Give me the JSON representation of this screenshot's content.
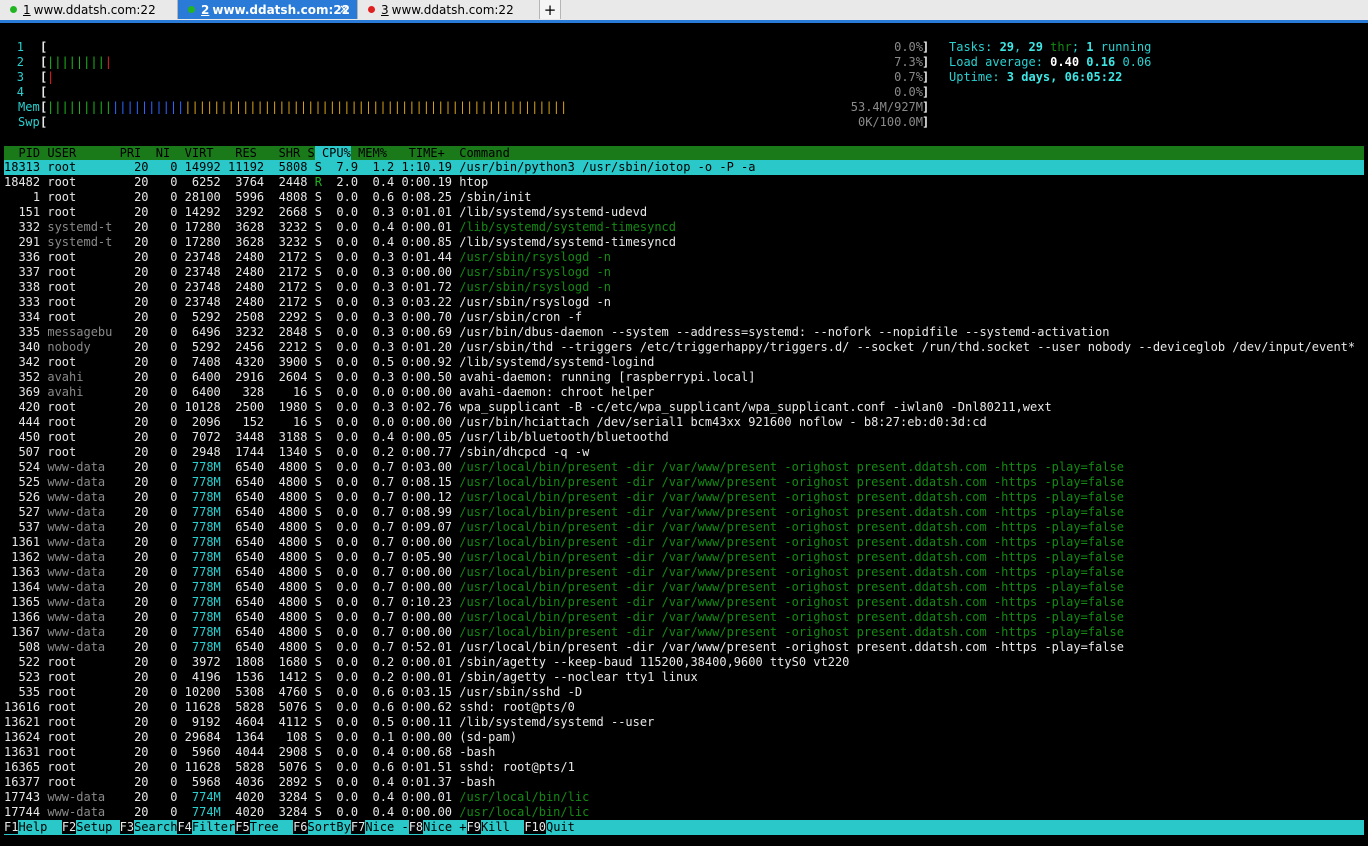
{
  "tabs": [
    {
      "num": "1",
      "title": "www.ddatsh.com:22",
      "dot": "#22b522",
      "active": false
    },
    {
      "num": "2",
      "title": "www.ddatsh.com:22",
      "dot": "#22b522",
      "active": true
    },
    {
      "num": "3",
      "title": "www.ddatsh.com:22",
      "dot": "#e02020",
      "active": false
    }
  ],
  "new_tab_label": "+",
  "close_glyph": "×",
  "meters": {
    "cpus": [
      {
        "label": "1",
        "bar": [],
        "value": "0.0%"
      },
      {
        "label": "2",
        "bar": [
          {
            "t": "||||||||",
            "c": "green"
          },
          {
            "t": "|",
            "c": "red"
          }
        ],
        "value": "7.3%"
      },
      {
        "label": "3",
        "bar": [
          {
            "t": "|",
            "c": "red"
          }
        ],
        "value": "0.7%"
      },
      {
        "label": "4",
        "bar": [],
        "value": "0.0%"
      }
    ],
    "mem": {
      "label": "Mem",
      "bar": [
        {
          "t": "|||||||||",
          "c": "green"
        },
        {
          "t": "||||||||||",
          "c": "blue"
        },
        {
          "t": "|||||||||||||||||||||||||||||||||||||||||||||||||||||",
          "c": "orange"
        }
      ],
      "value": "53.4M/927M"
    },
    "swp": {
      "label": "Swp",
      "bar": [],
      "value": "0K/100.0M"
    }
  },
  "summary": {
    "tasks_label": "Tasks: ",
    "tasks": "29",
    "sep": ", ",
    "threads": "29",
    "thr_label": " thr",
    "running_sep": "; ",
    "running": "1",
    "running_label": " running",
    "load_label": "Load average: ",
    "load1": "0.40",
    "load5": "0.16",
    "load15": "0.06",
    "uptime_label": "Uptime: ",
    "uptime": "3 days, 06:05:22"
  },
  "columns": [
    "  PID",
    " USER     ",
    " PRI",
    "  NI",
    "  VIRT",
    "   RES",
    "   SHR",
    " S",
    " CPU%",
    " MEM%",
    "   TIME+ ",
    " Command"
  ],
  "processes": [
    {
      "pid": "18313",
      "user": "root",
      "pri": "20",
      "ni": "0",
      "virt": "14992",
      "res": "11192",
      "shr": "5808",
      "s": "S",
      "cpu": "7.9",
      "mem": "1.2",
      "time": "1:10.19",
      "cmd": "/usr/bin/python3 /usr/sbin/iotop -o -P -a",
      "sel": true
    },
    {
      "pid": "18482",
      "user": "root",
      "pri": "20",
      "ni": "0",
      "virt": "6252",
      "res": "3764",
      "shr": "2448",
      "s": "R",
      "cpu": "2.0",
      "mem": "0.4",
      "time": "0:00.19",
      "cmd": "htop"
    },
    {
      "pid": "1",
      "user": "root",
      "pri": "20",
      "ni": "0",
      "virt": "28100",
      "res": "5996",
      "shr": "4808",
      "s": "S",
      "cpu": "0.0",
      "mem": "0.6",
      "time": "0:08.25",
      "cmd": "/sbin/init"
    },
    {
      "pid": "151",
      "user": "root",
      "pri": "20",
      "ni": "0",
      "virt": "14292",
      "res": "3292",
      "shr": "2668",
      "s": "S",
      "cpu": "0.0",
      "mem": "0.3",
      "time": "0:01.01",
      "cmd": "/lib/systemd/systemd-udevd"
    },
    {
      "pid": "332",
      "user": "systemd-t",
      "pri": "20",
      "ni": "0",
      "virt": "17280",
      "res": "3628",
      "shr": "3232",
      "s": "S",
      "cpu": "0.0",
      "mem": "0.4",
      "time": "0:00.01",
      "cmd": "/lib/systemd/systemd-timesyncd",
      "thread": true,
      "dimuser": true
    },
    {
      "pid": "291",
      "user": "systemd-t",
      "pri": "20",
      "ni": "0",
      "virt": "17280",
      "res": "3628",
      "shr": "3232",
      "s": "S",
      "cpu": "0.0",
      "mem": "0.4",
      "time": "0:00.85",
      "cmd": "/lib/systemd/systemd-timesyncd",
      "dimuser": true
    },
    {
      "pid": "336",
      "user": "root",
      "pri": "20",
      "ni": "0",
      "virt": "23748",
      "res": "2480",
      "shr": "2172",
      "s": "S",
      "cpu": "0.0",
      "mem": "0.3",
      "time": "0:01.44",
      "cmd": "/usr/sbin/rsyslogd -n",
      "thread": true
    },
    {
      "pid": "337",
      "user": "root",
      "pri": "20",
      "ni": "0",
      "virt": "23748",
      "res": "2480",
      "shr": "2172",
      "s": "S",
      "cpu": "0.0",
      "mem": "0.3",
      "time": "0:00.00",
      "cmd": "/usr/sbin/rsyslogd -n",
      "thread": true
    },
    {
      "pid": "338",
      "user": "root",
      "pri": "20",
      "ni": "0",
      "virt": "23748",
      "res": "2480",
      "shr": "2172",
      "s": "S",
      "cpu": "0.0",
      "mem": "0.3",
      "time": "0:01.72",
      "cmd": "/usr/sbin/rsyslogd -n",
      "thread": true
    },
    {
      "pid": "333",
      "user": "root",
      "pri": "20",
      "ni": "0",
      "virt": "23748",
      "res": "2480",
      "shr": "2172",
      "s": "S",
      "cpu": "0.0",
      "mem": "0.3",
      "time": "0:03.22",
      "cmd": "/usr/sbin/rsyslogd -n"
    },
    {
      "pid": "334",
      "user": "root",
      "pri": "20",
      "ni": "0",
      "virt": "5292",
      "res": "2508",
      "shr": "2292",
      "s": "S",
      "cpu": "0.0",
      "mem": "0.3",
      "time": "0:00.70",
      "cmd": "/usr/sbin/cron -f"
    },
    {
      "pid": "335",
      "user": "messagebu",
      "pri": "20",
      "ni": "0",
      "virt": "6496",
      "res": "3232",
      "shr": "2848",
      "s": "S",
      "cpu": "0.0",
      "mem": "0.3",
      "time": "0:00.69",
      "cmd": "/usr/bin/dbus-daemon --system --address=systemd: --nofork --nopidfile --systemd-activation",
      "dimuser": true
    },
    {
      "pid": "340",
      "user": "nobody",
      "pri": "20",
      "ni": "0",
      "virt": "5292",
      "res": "2456",
      "shr": "2212",
      "s": "S",
      "cpu": "0.0",
      "mem": "0.3",
      "time": "0:01.20",
      "cmd": "/usr/sbin/thd --triggers /etc/triggerhappy/triggers.d/ --socket /run/thd.socket --user nobody --deviceglob /dev/input/event*",
      "dimuser": true
    },
    {
      "pid": "342",
      "user": "root",
      "pri": "20",
      "ni": "0",
      "virt": "7408",
      "res": "4320",
      "shr": "3900",
      "s": "S",
      "cpu": "0.0",
      "mem": "0.5",
      "time": "0:00.92",
      "cmd": "/lib/systemd/systemd-logind"
    },
    {
      "pid": "352",
      "user": "avahi",
      "pri": "20",
      "ni": "0",
      "virt": "6400",
      "res": "2916",
      "shr": "2604",
      "s": "S",
      "cpu": "0.0",
      "mem": "0.3",
      "time": "0:00.50",
      "cmd": "avahi-daemon: running [raspberrypi.local]",
      "dimuser": true
    },
    {
      "pid": "369",
      "user": "avahi",
      "pri": "20",
      "ni": "0",
      "virt": "6400",
      "res": "328",
      "shr": "16",
      "s": "S",
      "cpu": "0.0",
      "mem": "0.0",
      "time": "0:00.00",
      "cmd": "avahi-daemon: chroot helper",
      "dimuser": true
    },
    {
      "pid": "420",
      "user": "root",
      "pri": "20",
      "ni": "0",
      "virt": "10128",
      "res": "2500",
      "shr": "1980",
      "s": "S",
      "cpu": "0.0",
      "mem": "0.3",
      "time": "0:02.76",
      "cmd": "wpa_supplicant -B -c/etc/wpa_supplicant/wpa_supplicant.conf -iwlan0 -Dnl80211,wext"
    },
    {
      "pid": "444",
      "user": "root",
      "pri": "20",
      "ni": "0",
      "virt": "2096",
      "res": "152",
      "shr": "16",
      "s": "S",
      "cpu": "0.0",
      "mem": "0.0",
      "time": "0:00.00",
      "cmd": "/usr/bin/hciattach /dev/serial1 bcm43xx 921600 noflow - b8:27:eb:d0:3d:cd"
    },
    {
      "pid": "450",
      "user": "root",
      "pri": "20",
      "ni": "0",
      "virt": "7072",
      "res": "3448",
      "shr": "3188",
      "s": "S",
      "cpu": "0.0",
      "mem": "0.4",
      "time": "0:00.05",
      "cmd": "/usr/lib/bluetooth/bluetoothd"
    },
    {
      "pid": "507",
      "user": "root",
      "pri": "20",
      "ni": "0",
      "virt": "2948",
      "res": "1744",
      "shr": "1340",
      "s": "S",
      "cpu": "0.0",
      "mem": "0.2",
      "time": "0:00.77",
      "cmd": "/sbin/dhcpcd -q -w"
    },
    {
      "pid": "524",
      "user": "www-data",
      "pri": "20",
      "ni": "0",
      "virt": "778M",
      "res": "6540",
      "shr": "4800",
      "s": "S",
      "cpu": "0.0",
      "mem": "0.7",
      "time": "0:03.00",
      "cmd": "/usr/local/bin/present -dir /var/www/present -orighost present.ddatsh.com -https -play=false",
      "thread": true,
      "dimuser": true
    },
    {
      "pid": "525",
      "user": "www-data",
      "pri": "20",
      "ni": "0",
      "virt": "778M",
      "res": "6540",
      "shr": "4800",
      "s": "S",
      "cpu": "0.0",
      "mem": "0.7",
      "time": "0:08.15",
      "cmd": "/usr/local/bin/present -dir /var/www/present -orighost present.ddatsh.com -https -play=false",
      "thread": true,
      "dimuser": true
    },
    {
      "pid": "526",
      "user": "www-data",
      "pri": "20",
      "ni": "0",
      "virt": "778M",
      "res": "6540",
      "shr": "4800",
      "s": "S",
      "cpu": "0.0",
      "mem": "0.7",
      "time": "0:00.12",
      "cmd": "/usr/local/bin/present -dir /var/www/present -orighost present.ddatsh.com -https -play=false",
      "thread": true,
      "dimuser": true
    },
    {
      "pid": "527",
      "user": "www-data",
      "pri": "20",
      "ni": "0",
      "virt": "778M",
      "res": "6540",
      "shr": "4800",
      "s": "S",
      "cpu": "0.0",
      "mem": "0.7",
      "time": "0:08.99",
      "cmd": "/usr/local/bin/present -dir /var/www/present -orighost present.ddatsh.com -https -play=false",
      "thread": true,
      "dimuser": true
    },
    {
      "pid": "537",
      "user": "www-data",
      "pri": "20",
      "ni": "0",
      "virt": "778M",
      "res": "6540",
      "shr": "4800",
      "s": "S",
      "cpu": "0.0",
      "mem": "0.7",
      "time": "0:09.07",
      "cmd": "/usr/local/bin/present -dir /var/www/present -orighost present.ddatsh.com -https -play=false",
      "thread": true,
      "dimuser": true
    },
    {
      "pid": "1361",
      "user": "www-data",
      "pri": "20",
      "ni": "0",
      "virt": "778M",
      "res": "6540",
      "shr": "4800",
      "s": "S",
      "cpu": "0.0",
      "mem": "0.7",
      "time": "0:00.00",
      "cmd": "/usr/local/bin/present -dir /var/www/present -orighost present.ddatsh.com -https -play=false",
      "thread": true,
      "dimuser": true
    },
    {
      "pid": "1362",
      "user": "www-data",
      "pri": "20",
      "ni": "0",
      "virt": "778M",
      "res": "6540",
      "shr": "4800",
      "s": "S",
      "cpu": "0.0",
      "mem": "0.7",
      "time": "0:05.90",
      "cmd": "/usr/local/bin/present -dir /var/www/present -orighost present.ddatsh.com -https -play=false",
      "thread": true,
      "dimuser": true
    },
    {
      "pid": "1363",
      "user": "www-data",
      "pri": "20",
      "ni": "0",
      "virt": "778M",
      "res": "6540",
      "shr": "4800",
      "s": "S",
      "cpu": "0.0",
      "mem": "0.7",
      "time": "0:00.00",
      "cmd": "/usr/local/bin/present -dir /var/www/present -orighost present.ddatsh.com -https -play=false",
      "thread": true,
      "dimuser": true
    },
    {
      "pid": "1364",
      "user": "www-data",
      "pri": "20",
      "ni": "0",
      "virt": "778M",
      "res": "6540",
      "shr": "4800",
      "s": "S",
      "cpu": "0.0",
      "mem": "0.7",
      "time": "0:00.00",
      "cmd": "/usr/local/bin/present -dir /var/www/present -orighost present.ddatsh.com -https -play=false",
      "thread": true,
      "dimuser": true
    },
    {
      "pid": "1365",
      "user": "www-data",
      "pri": "20",
      "ni": "0",
      "virt": "778M",
      "res": "6540",
      "shr": "4800",
      "s": "S",
      "cpu": "0.0",
      "mem": "0.7",
      "time": "0:10.23",
      "cmd": "/usr/local/bin/present -dir /var/www/present -orighost present.ddatsh.com -https -play=false",
      "thread": true,
      "dimuser": true
    },
    {
      "pid": "1366",
      "user": "www-data",
      "pri": "20",
      "ni": "0",
      "virt": "778M",
      "res": "6540",
      "shr": "4800",
      "s": "S",
      "cpu": "0.0",
      "mem": "0.7",
      "time": "0:00.00",
      "cmd": "/usr/local/bin/present -dir /var/www/present -orighost present.ddatsh.com -https -play=false",
      "thread": true,
      "dimuser": true
    },
    {
      "pid": "1367",
      "user": "www-data",
      "pri": "20",
      "ni": "0",
      "virt": "778M",
      "res": "6540",
      "shr": "4800",
      "s": "S",
      "cpu": "0.0",
      "mem": "0.7",
      "time": "0:00.00",
      "cmd": "/usr/local/bin/present -dir /var/www/present -orighost present.ddatsh.com -https -play=false",
      "thread": true,
      "dimuser": true
    },
    {
      "pid": "508",
      "user": "www-data",
      "pri": "20",
      "ni": "0",
      "virt": "778M",
      "res": "6540",
      "shr": "4800",
      "s": "S",
      "cpu": "0.0",
      "mem": "0.7",
      "time": "0:52.01",
      "cmd": "/usr/local/bin/present -dir /var/www/present -orighost present.ddatsh.com -https -play=false",
      "dimuser": true
    },
    {
      "pid": "522",
      "user": "root",
      "pri": "20",
      "ni": "0",
      "virt": "3972",
      "res": "1808",
      "shr": "1680",
      "s": "S",
      "cpu": "0.0",
      "mem": "0.2",
      "time": "0:00.01",
      "cmd": "/sbin/agetty --keep-baud 115200,38400,9600 ttyS0 vt220"
    },
    {
      "pid": "523",
      "user": "root",
      "pri": "20",
      "ni": "0",
      "virt": "4196",
      "res": "1536",
      "shr": "1412",
      "s": "S",
      "cpu": "0.0",
      "mem": "0.2",
      "time": "0:00.01",
      "cmd": "/sbin/agetty --noclear tty1 linux"
    },
    {
      "pid": "535",
      "user": "root",
      "pri": "20",
      "ni": "0",
      "virt": "10200",
      "res": "5308",
      "shr": "4760",
      "s": "S",
      "cpu": "0.0",
      "mem": "0.6",
      "time": "0:03.15",
      "cmd": "/usr/sbin/sshd -D"
    },
    {
      "pid": "13616",
      "user": "root",
      "pri": "20",
      "ni": "0",
      "virt": "11628",
      "res": "5828",
      "shr": "5076",
      "s": "S",
      "cpu": "0.0",
      "mem": "0.6",
      "time": "0:00.62",
      "cmd": "sshd: root@pts/0"
    },
    {
      "pid": "13621",
      "user": "root",
      "pri": "20",
      "ni": "0",
      "virt": "9192",
      "res": "4604",
      "shr": "4112",
      "s": "S",
      "cpu": "0.0",
      "mem": "0.5",
      "time": "0:00.11",
      "cmd": "/lib/systemd/systemd --user"
    },
    {
      "pid": "13624",
      "user": "root",
      "pri": "20",
      "ni": "0",
      "virt": "29684",
      "res": "1364",
      "shr": "108",
      "s": "S",
      "cpu": "0.0",
      "mem": "0.1",
      "time": "0:00.00",
      "cmd": "(sd-pam)"
    },
    {
      "pid": "13631",
      "user": "root",
      "pri": "20",
      "ni": "0",
      "virt": "5960",
      "res": "4044",
      "shr": "2908",
      "s": "S",
      "cpu": "0.0",
      "mem": "0.4",
      "time": "0:00.68",
      "cmd": "-bash"
    },
    {
      "pid": "16365",
      "user": "root",
      "pri": "20",
      "ni": "0",
      "virt": "11628",
      "res": "5828",
      "shr": "5076",
      "s": "S",
      "cpu": "0.0",
      "mem": "0.6",
      "time": "0:01.51",
      "cmd": "sshd: root@pts/1"
    },
    {
      "pid": "16377",
      "user": "root",
      "pri": "20",
      "ni": "0",
      "virt": "5968",
      "res": "4036",
      "shr": "2892",
      "s": "S",
      "cpu": "0.0",
      "mem": "0.4",
      "time": "0:01.37",
      "cmd": "-bash"
    },
    {
      "pid": "17743",
      "user": "www-data",
      "pri": "20",
      "ni": "0",
      "virt": "774M",
      "res": "4020",
      "shr": "3284",
      "s": "S",
      "cpu": "0.0",
      "mem": "0.4",
      "time": "0:00.01",
      "cmd": "/usr/local/bin/lic",
      "thread": true,
      "dimuser": true
    },
    {
      "pid": "17744",
      "user": "www-data",
      "pri": "20",
      "ni": "0",
      "virt": "774M",
      "res": "4020",
      "shr": "3284",
      "s": "S",
      "cpu": "0.0",
      "mem": "0.4",
      "time": "0:00.00",
      "cmd": "/usr/local/bin/lic",
      "thread": true,
      "dimuser": true
    }
  ],
  "fkeys": [
    {
      "key": "F1",
      "label": "Help  "
    },
    {
      "key": "F2",
      "label": "Setup "
    },
    {
      "key": "F3",
      "label": "Search"
    },
    {
      "key": "F4",
      "label": "Filter"
    },
    {
      "key": "F5",
      "label": "Tree  "
    },
    {
      "key": "F6",
      "label": "SortBy"
    },
    {
      "key": "F7",
      "label": "Nice -"
    },
    {
      "key": "F8",
      "label": "Nice +"
    },
    {
      "key": "F9",
      "label": "Kill  "
    },
    {
      "key": "F10",
      "label": "Quit"
    }
  ],
  "colors": {
    "green": "#1eb31e",
    "red": "#e02020",
    "blue": "#2a66ff",
    "orange": "#d4a017",
    "cyan": "#2ac8c8",
    "thread_green": "#148a14",
    "header_green": "#1a7a1a"
  }
}
